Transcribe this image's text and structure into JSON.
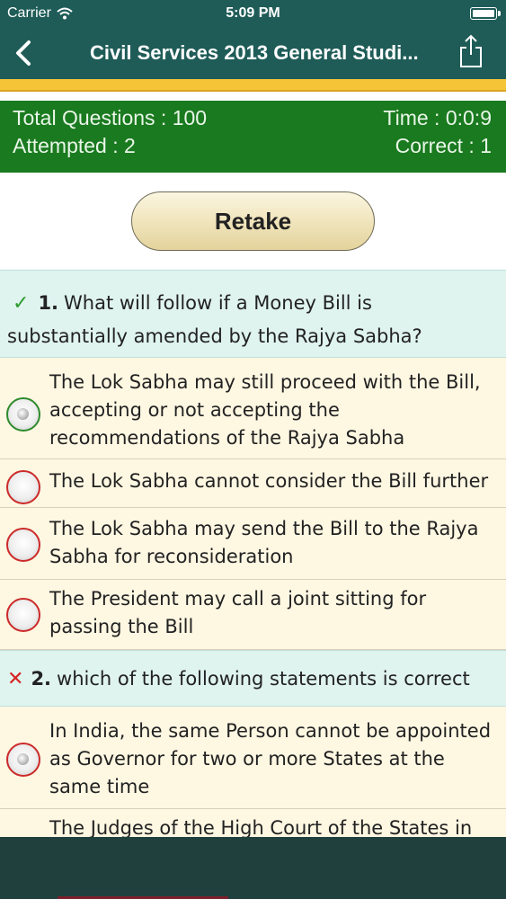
{
  "status_bar": {
    "carrier": "Carrier",
    "time": "5:09 PM"
  },
  "header": {
    "title": "Civil Services 2013 General Studi..."
  },
  "stats": {
    "total_questions": "Total Questions : 100",
    "time": "Time : 0:0:9",
    "attempted": "Attempted : 2",
    "correct": "Correct : 1"
  },
  "retake_label": "Retake",
  "questions": [
    {
      "mark": "✓",
      "number": "1.",
      "text": "What will follow if a Money Bill is substantially amended by the Rajya Sabha?",
      "options": [
        {
          "text": "The Lok Sabha may still proceed with the Bill, accepting or not accepting the recommendations of the Rajya Sabha",
          "selected": true,
          "status": "correct"
        },
        {
          "text": "The Lok Sabha cannot consider the Bill further",
          "selected": false,
          "status": "wrong"
        },
        {
          "text": "The Lok Sabha may send the Bill to the Rajya Sabha for reconsideration",
          "selected": false,
          "status": "wrong"
        },
        {
          "text": "The President may call a joint sitting for passing the Bill",
          "selected": false,
          "status": "wrong"
        }
      ]
    },
    {
      "mark": "✕",
      "number": "2.",
      "text": "which of the following statements is correct",
      "options": [
        {
          "text": "In India, the same Person cannot be appointed as Governor for two or more States at the same time",
          "selected": true,
          "status": "wrong"
        },
        {
          "text": "The Judges of the High Court of the States in",
          "selected": false,
          "status": "wrong"
        }
      ]
    }
  ],
  "colors": {
    "nav": "#1f5c58",
    "gold": "#f5c437",
    "stats_bg": "#1a7a1f",
    "question_bg": "#dff3ef",
    "option_bg": "#fef7e2",
    "correct": "#2e8b2e",
    "wrong": "#cc2a2a"
  },
  "icons": [
    "wifi-icon",
    "battery-icon",
    "back-chevron-icon",
    "share-icon",
    "check-icon",
    "cross-icon",
    "radio-icon"
  ]
}
